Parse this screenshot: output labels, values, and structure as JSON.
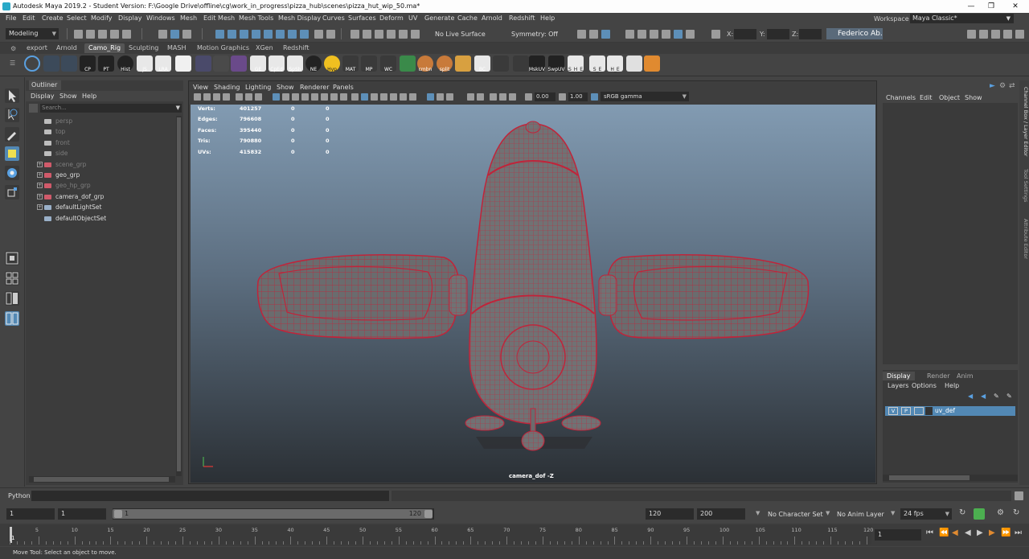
{
  "window": {
    "title": "Autodesk Maya 2019.2 - Student Version: F:\\Google Drive\\offline\\cg\\work_in_progress\\pizza_hub\\scenes\\pizza_hut_wip_50.ma*"
  },
  "menubar": {
    "items": [
      "File",
      "Edit",
      "Create",
      "Select",
      "Modify",
      "Display",
      "Windows",
      "Mesh",
      "Edit Mesh",
      "Mesh Tools",
      "Mesh Display",
      "Curves",
      "Surfaces",
      "Deform",
      "UV",
      "Generate",
      "Cache",
      "Arnold",
      "Redshift",
      "Help"
    ],
    "workspace_label": "Workspace :",
    "workspace_value": "Maya Classic*"
  },
  "statusline": {
    "mode": "Modeling",
    "live_surface": "No Live Surface",
    "symmetry": "Symmetry: Off",
    "x_label": "X:",
    "y_label": "Y:",
    "z_label": "Z:",
    "user": "Federico Ab."
  },
  "shelf": {
    "tabs": [
      "export",
      "Arnold",
      "Camo_Rig",
      "Sculpting",
      "MASH",
      "Motion Graphics",
      "XGen",
      "Redshift"
    ],
    "active_tab": "Camo_Rig",
    "buttons": [
      "CP",
      "PT",
      "Hist",
      "JS",
      "LRA",
      "",
      "",
      "",
      "GE",
      "CpEd",
      "SpSh",
      "NE",
      "Hyp",
      "MAT",
      "MP",
      "WC",
      "",
      "cmbn",
      "split",
      "",
      "BC",
      "",
      "",
      "MskUV",
      "SwpUV",
      "S_H_E",
      "",
      "S_E",
      "H_E",
      "",
      ""
    ]
  },
  "outliner": {
    "tab": "Outliner",
    "menu": [
      "Display",
      "Show",
      "Help"
    ],
    "search_placeholder": "Search...",
    "items": [
      {
        "label": "persp",
        "dim": true,
        "expand": false,
        "icon": "camera"
      },
      {
        "label": "top",
        "dim": true,
        "expand": false,
        "icon": "camera"
      },
      {
        "label": "front",
        "dim": true,
        "expand": false,
        "icon": "camera"
      },
      {
        "label": "side",
        "dim": true,
        "expand": false,
        "icon": "camera"
      },
      {
        "label": "scene_grp",
        "dim": true,
        "expand": true,
        "icon": "group"
      },
      {
        "label": "geo_grp",
        "dim": false,
        "expand": true,
        "icon": "group"
      },
      {
        "label": "geo_hp_grp",
        "dim": true,
        "expand": true,
        "icon": "group"
      },
      {
        "label": "camera_dof_grp",
        "dim": false,
        "expand": true,
        "icon": "group"
      },
      {
        "label": "defaultLightSet",
        "dim": false,
        "expand": true,
        "icon": "set"
      },
      {
        "label": "defaultObjectSet",
        "dim": false,
        "expand": false,
        "icon": "set"
      }
    ]
  },
  "viewport": {
    "menu": [
      "View",
      "Shading",
      "Lighting",
      "Show",
      "Renderer",
      "Panels"
    ],
    "near_value": "0.00",
    "far_value": "1.00",
    "color_space": "sRGB gamma",
    "camera_label": "camera_dof -Z",
    "hud": [
      {
        "label": "Verts:",
        "v1": "401257",
        "v2": "0",
        "v3": "0"
      },
      {
        "label": "Edges:",
        "v1": "796608",
        "v2": "0",
        "v3": "0"
      },
      {
        "label": "Faces:",
        "v1": "395440",
        "v2": "0",
        "v3": "0"
      },
      {
        "label": "Tris:",
        "v1": "790880",
        "v2": "0",
        "v3": "0"
      },
      {
        "label": "UVs:",
        "v1": "415832",
        "v2": "0",
        "v3": "0"
      }
    ]
  },
  "channelbox": {
    "menu": [
      "Channels",
      "Edit",
      "Object",
      "Show"
    ],
    "layer_tabs": [
      "Display",
      "Render",
      "Anim"
    ],
    "layer_menu": [
      "Layers",
      "Options",
      "Help"
    ],
    "layer": {
      "v": "V",
      "p": "P",
      "name": "uv_def"
    },
    "side_tabs": [
      "Channel Box / Layer Editor",
      "Tool Settings",
      "Attribute Editor"
    ]
  },
  "commandline": {
    "label": "Python"
  },
  "range": {
    "start": "1",
    "playback_start": "1",
    "slider_start": "1",
    "slider_end": "120",
    "playback_end": "120",
    "end": "200",
    "character_set": "No Character Set",
    "anim_layer": "No Anim Layer",
    "fps": "24 fps"
  },
  "timeline": {
    "ticks": [
      "5",
      "10",
      "15",
      "20",
      "25",
      "30",
      "35",
      "40",
      "45",
      "50",
      "55",
      "60",
      "65",
      "70",
      "75",
      "80",
      "85",
      "90",
      "95",
      "100",
      "105",
      "110",
      "115",
      "120"
    ],
    "current_frame": "1",
    "frame_field": "1"
  },
  "helpline": {
    "text": "Move Tool: Select an object to move."
  }
}
